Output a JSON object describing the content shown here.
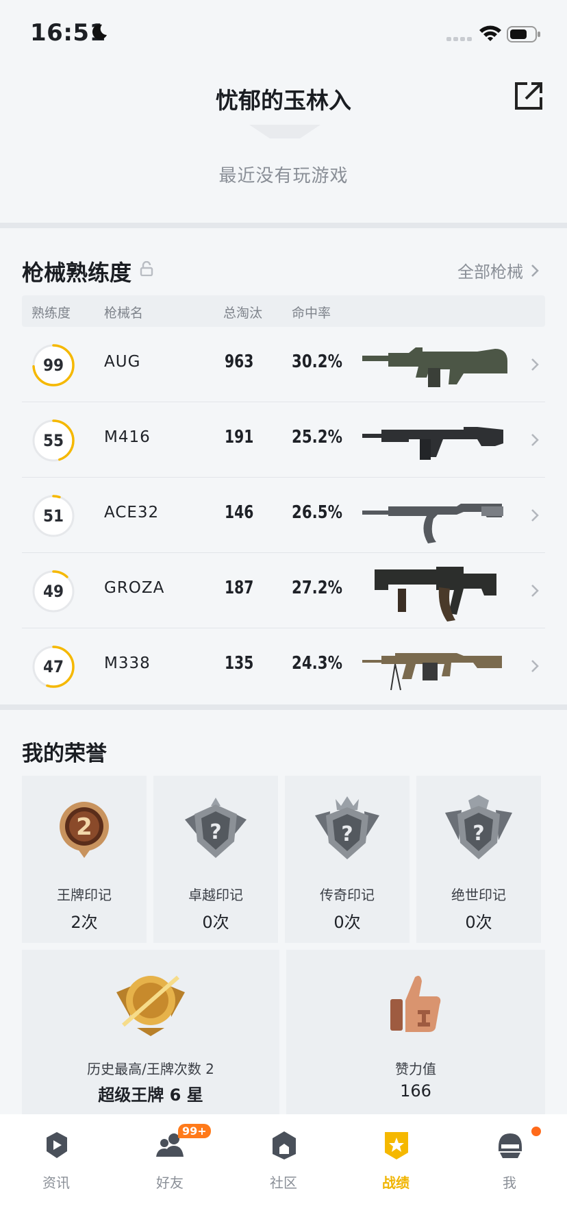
{
  "status_bar": {
    "time": "16:51"
  },
  "header": {
    "title": "忧郁的玉林入",
    "status": "最近没有玩游戏"
  },
  "weapons": {
    "title": "枪械熟练度",
    "all_link": "全部枪械",
    "columns": [
      "熟练度",
      "枪械名",
      "总淘汰",
      "命中率"
    ],
    "rows": [
      {
        "mastery": "99",
        "mastery_level": 0.74,
        "name": "AUG",
        "kills": "963",
        "hit_rate": "30.2%",
        "image": "aug-rifle"
      },
      {
        "mastery": "55",
        "mastery_level": 0.45,
        "name": "M416",
        "kills": "191",
        "hit_rate": "25.2%",
        "image": "m416-rifle"
      },
      {
        "mastery": "51",
        "mastery_level": 0.05,
        "name": "ACE32",
        "kills": "146",
        "hit_rate": "26.5%",
        "image": "ace32-rifle"
      },
      {
        "mastery": "49",
        "mastery_level": 0.12,
        "name": "GROZA",
        "kills": "187",
        "hit_rate": "27.2%",
        "image": "groza-rifle"
      },
      {
        "mastery": "47",
        "mastery_level": 0.55,
        "name": "M338",
        "kills": "135",
        "hit_rate": "24.3%",
        "image": "m338-machinegun"
      }
    ]
  },
  "honors": {
    "title": "我的荣誉",
    "badges": [
      {
        "name": "王牌印记",
        "count": "2次",
        "icon": "ace-badge-icon"
      },
      {
        "name": "卓越印记",
        "count": "0次",
        "icon": "locked-badge-icon"
      },
      {
        "name": "传奇印记",
        "count": "0次",
        "icon": "locked-badge-icon"
      },
      {
        "name": "绝世印记",
        "count": "0次",
        "icon": "locked-badge-icon"
      }
    ],
    "highest": {
      "label": "历史最高/王牌次数 2",
      "value": "超级王牌 6 星",
      "icon": "rank-emblem-icon"
    },
    "likes": {
      "label": "赞力值",
      "value": "166",
      "icon": "thumbs-up-icon"
    }
  },
  "tabbar": {
    "tabs": [
      {
        "label": "资讯",
        "icon": "news-icon"
      },
      {
        "label": "好友",
        "icon": "friends-icon",
        "badge": "99+"
      },
      {
        "label": "社区",
        "icon": "community-icon"
      },
      {
        "label": "战绩",
        "icon": "record-icon",
        "active": true
      },
      {
        "label": "我",
        "icon": "me-icon"
      }
    ]
  },
  "colors": {
    "accent": "#f5b800",
    "ring_track": "#e6e8eb",
    "badge_orange": "#ff7a1a"
  }
}
